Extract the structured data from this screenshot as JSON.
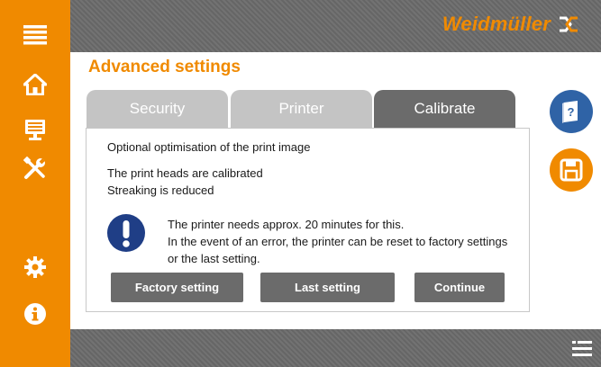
{
  "brand": {
    "name": "Weidmüller"
  },
  "page": {
    "title": "Advanced settings"
  },
  "tabs": [
    {
      "label": "Security",
      "active": false
    },
    {
      "label": "Printer",
      "active": false
    },
    {
      "label": "Calibrate",
      "active": true
    }
  ],
  "panel": {
    "line1": "Optional optimisation of the print image",
    "line2": "The print heads are calibrated",
    "line3": "Streaking is reduced",
    "notice": [
      "The printer needs approx. 20 minutes for this.",
      "In the event of an error, the printer can be reset to factory settings",
      "or the last setting."
    ]
  },
  "buttons": {
    "factory": "Factory setting",
    "last": "Last setting",
    "continue": "Continue"
  },
  "sidebar_icons": [
    "menu-icon",
    "home-icon",
    "monitor-icon",
    "tools-icon",
    "gear-icon",
    "info-icon"
  ],
  "colors": {
    "accent": "#f08a00",
    "dark_gray": "#6b6b6b",
    "inactive_tab": "#c4c4c4",
    "info_blue": "#1f3e86",
    "help_blue": "#2f63a6"
  }
}
